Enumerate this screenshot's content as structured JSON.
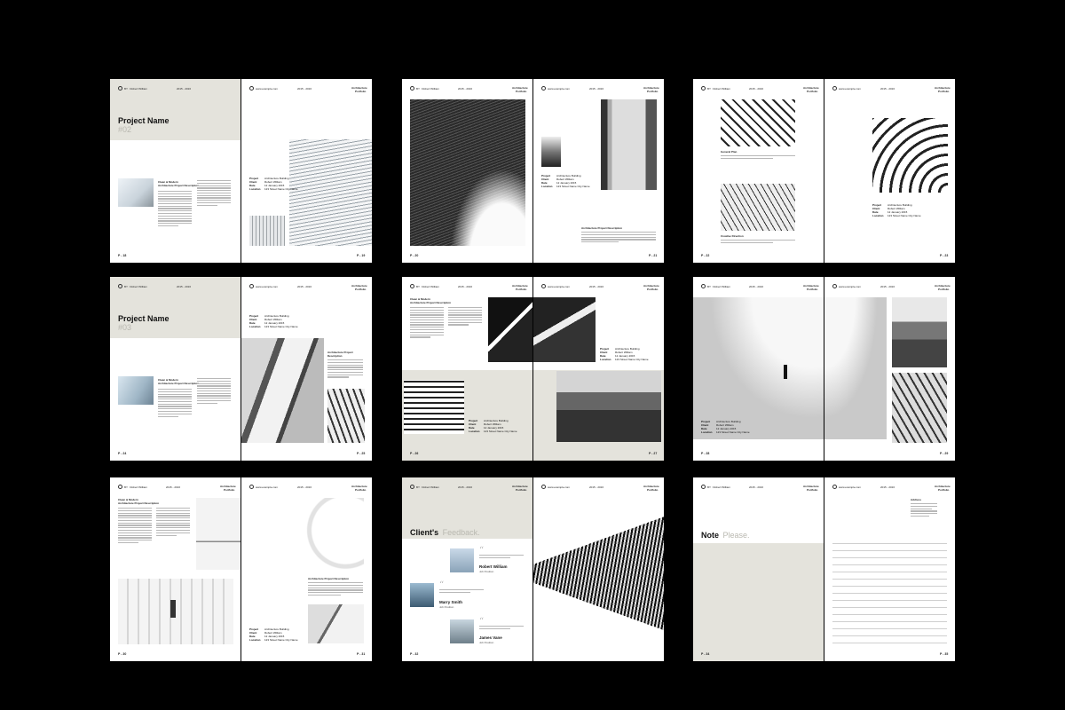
{
  "header": {
    "author": "BY : Robert William",
    "years": "2015 - 2016",
    "site": "www.example.com",
    "topic_line1": "Architecture",
    "topic_line2": "Portfolio"
  },
  "project_02": {
    "title": "Project Name",
    "number": "#02"
  },
  "project_03": {
    "title": "Project Name",
    "number": "#03"
  },
  "section": {
    "clean_line1": "Clean & Modern",
    "clean_line2": "Architecture Project Description",
    "desc_single": "Architecture Project Description",
    "desc_line1": "Architecture Project",
    "desc_line2": "Description",
    "general_plan": "General Plan",
    "creative_direction": "Creative Direction"
  },
  "project_info": {
    "labels": [
      "Project",
      "Client",
      "Date",
      "Location"
    ],
    "values": [
      "Architecture Building",
      "Robert William",
      "12 January 2015",
      "123 Street Name City Name"
    ]
  },
  "feedback": {
    "title_bold": "Client's",
    "title_light": "Feedback.",
    "clients": [
      {
        "name": "Robert William",
        "role": "Job Position"
      },
      {
        "name": "Marry Smith",
        "role": "Job Position"
      },
      {
        "name": "James Vane",
        "role": "Job Position"
      }
    ]
  },
  "note": {
    "bold": "Note",
    "light": "Please.",
    "address_title": "Address"
  },
  "page_numbers": {
    "p18": "P - 18",
    "p19": "P - 19",
    "p20": "P - 20",
    "p21": "P - 21",
    "p22": "P - 22",
    "p23": "P - 23",
    "p24": "P - 24",
    "p25": "P - 25",
    "p26": "P - 26",
    "p27": "P - 27",
    "p28": "P - 28",
    "p29": "P - 29",
    "p30": "P - 30",
    "p31": "P - 31",
    "p32": "P - 32",
    "p33": "P - 33",
    "p34": "P - 34",
    "p35": "P - 35"
  },
  "colors": {
    "background": "#000000",
    "page": "#ffffff",
    "beige": "#e4e3dc",
    "accent_grey": "#b9b8b0"
  },
  "icons": [
    "circle-logo-icon",
    "quote-icon"
  ]
}
